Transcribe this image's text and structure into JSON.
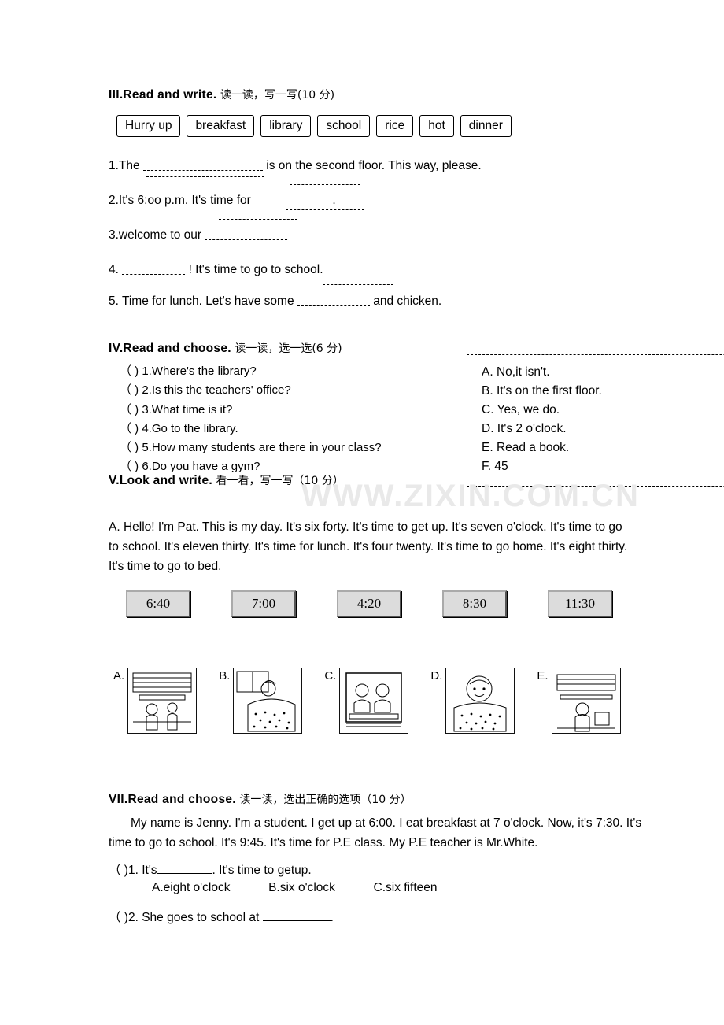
{
  "sections": {
    "three": {
      "title": "III.Read and write.",
      "cn": "读一读，写一写(10 分)",
      "words": [
        "Hurry up",
        "breakfast",
        "library",
        "school",
        "rice",
        "hot",
        "dinner"
      ],
      "items": [
        {
          "pre": "1.The",
          "post": "is on the second floor. This way, please."
        },
        {
          "pre": "2.It's 6:oo p.m. It's time for",
          "post": "."
        },
        {
          "pre": "3.welcome to our",
          "post": ""
        },
        {
          "pre": "4.",
          "post": "! It's time to go to school."
        },
        {
          "pre": "5. Time for lunch. Let's have some",
          "post": "and chicken."
        }
      ]
    },
    "four": {
      "title": "IV.Read and choose.",
      "cn": "读一读，选一选(6 分)",
      "questions": [
        "（    ) 1.Where's the library?",
        "（    ) 2.Is this the teachers' office?",
        "（    ) 3.What time is it?",
        "（    ) 4.Go to the library.",
        "（    ) 5.How many students are there in your class?",
        "（    ) 6.Do you have a gym?"
      ],
      "answers": [
        "A.  No,it isn't.",
        "B.  It's on the first floor.",
        "C.  Yes, we do.",
        "D.  It's 2 o'clock.",
        "E.  Read a book.",
        "F.  45"
      ]
    },
    "five": {
      "title": "V.Look and write.",
      "cn": "看一看，写一写（10 分）",
      "watermark": "WWW.ZIXIN.COM.CN",
      "paragraph": "A. Hello! I'm Pat. This is my day. It's six forty. It's time to get up. It's seven o'clock. It's time to go to school. It's eleven thirty. It's time for lunch. It's four twenty. It's time to go home. It's eight thirty. It's time to go to bed.",
      "clocks": [
        "6:40",
        "7:00",
        "4:20",
        "8:30",
        "11:30"
      ],
      "picture_labels": [
        "A.",
        "B.",
        "C.",
        "D.",
        "E."
      ]
    },
    "seven": {
      "title": "VII.Read and choose.",
      "cn": "读一读，选出正确的选项（10 分）",
      "paragraph": "My name is Jenny. I'm a student. I get up at 6:00.   I eat breakfast at 7 o'clock. Now, it's   7:30. It's time to go to school. It's   9:45.   It's time for P.E class.   My P.E teacher is Mr.White.",
      "q1": {
        "pre": "（      )1. It's",
        "post": ". It's time to getup."
      },
      "q1_options": [
        "A.eight o'clock",
        "B.six  o'clock",
        "C.six  fifteen"
      ],
      "q2": {
        "pre": "（      )2. She goes to school at",
        "post": "."
      }
    }
  }
}
